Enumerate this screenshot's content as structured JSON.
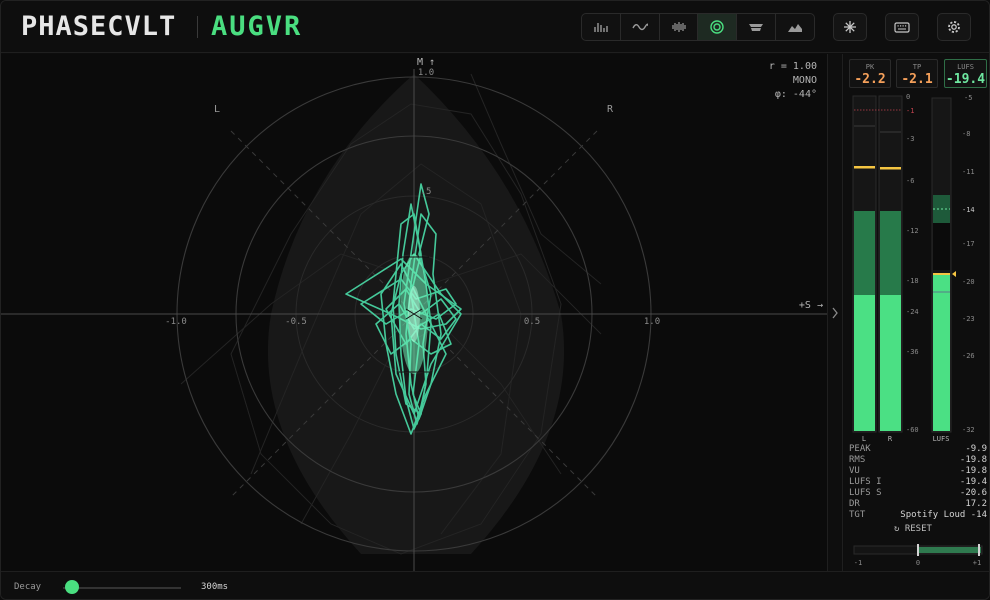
{
  "header": {
    "brand": "PHASECVLT",
    "product": "AUGVR",
    "modes": [
      {
        "icon": "spectrum-bars-icon",
        "active": false
      },
      {
        "icon": "waveform-icon",
        "active": false
      },
      {
        "icon": "spectrogram-icon",
        "active": false
      },
      {
        "icon": "target-icon",
        "active": true
      },
      {
        "icon": "stack-icon",
        "active": false
      },
      {
        "icon": "mountain-icon",
        "active": false
      }
    ],
    "tools": [
      "sparkle-icon",
      "keyboard-icon",
      "gear-icon"
    ]
  },
  "scope": {
    "readout": {
      "r": "r = 1.00",
      "mode": "MONO",
      "phi": "φ: -44°"
    },
    "labels": {
      "m_axis": "M ↑",
      "m_val": "1.0",
      "s_axis": "+S →",
      "left": "L",
      "right": "R",
      "half": ".5",
      "ticks": [
        "-1.0",
        "-0.5",
        "0.5",
        "1.0"
      ]
    }
  },
  "meters": {
    "boxes": [
      {
        "label": "PK",
        "value": "-2.2"
      },
      {
        "label": "TP",
        "value": "-2.1"
      },
      {
        "label": "LUFS",
        "value": "-19.4"
      }
    ],
    "db_scale": [
      "0",
      "-1",
      "-3",
      "-6",
      "-12",
      "-18",
      "-24",
      "-36",
      "-60"
    ],
    "lufs_scale": [
      "-5",
      "-8",
      "-11",
      "-14",
      "-17",
      "-20",
      "-23",
      "-26",
      "-32"
    ],
    "channel_labels": [
      "L",
      "R",
      "LUFS"
    ],
    "stats": [
      {
        "key": "PEAK",
        "value": "-9.9"
      },
      {
        "key": "RMS",
        "value": "-19.8"
      },
      {
        "key": "VU",
        "value": "-19.8"
      },
      {
        "key": "LUFS I",
        "value": "-19.4"
      },
      {
        "key": "LUFS S",
        "value": "-20.6"
      },
      {
        "key": "DR",
        "value": "17.2"
      },
      {
        "key": "TGT",
        "value": "Spotify Loud -14"
      }
    ],
    "reset": "↻ RESET",
    "corr_labels": [
      "-1",
      "0",
      "+1"
    ]
  },
  "footer": {
    "decay_label": "Decay",
    "decay_value": "300ms"
  },
  "colors": {
    "accent": "#4ade80",
    "trace": "#45c99a",
    "warn": "#f5a05a",
    "peak": "#f5c542"
  }
}
